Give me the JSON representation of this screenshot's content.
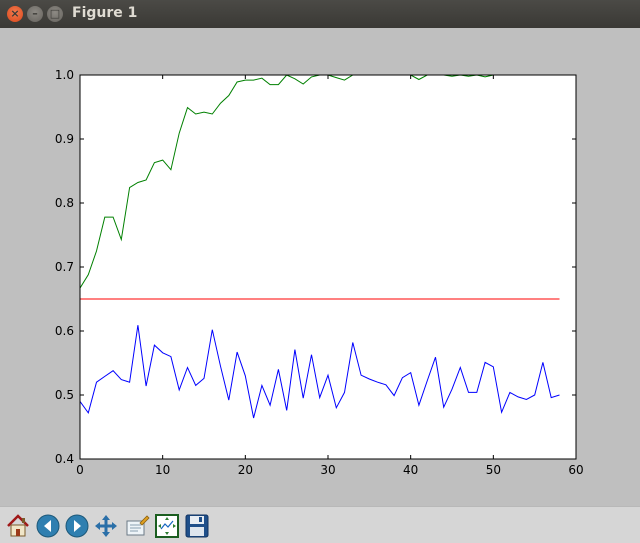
{
  "window": {
    "title": "Figure 1"
  },
  "toolbar": {
    "buttons": [
      {
        "name": "home-button",
        "icon": "home-icon"
      },
      {
        "name": "back-button",
        "icon": "arrow-left-icon"
      },
      {
        "name": "forward-button",
        "icon": "arrow-right-icon"
      },
      {
        "name": "pan-button",
        "icon": "move-icon"
      },
      {
        "name": "zoom-button",
        "icon": "zoom-rect-icon"
      },
      {
        "name": "subplots-button",
        "icon": "configure-subplots-icon"
      },
      {
        "name": "save-button",
        "icon": "floppy-disk-icon"
      }
    ]
  },
  "chart_data": {
    "type": "line",
    "xlim": [
      0,
      60
    ],
    "ylim": [
      0.4,
      1.0
    ],
    "xticks": [
      "0",
      "10",
      "20",
      "30",
      "40",
      "50",
      "60"
    ],
    "yticks": [
      "0.4",
      "0.5",
      "0.6",
      "0.7",
      "0.8",
      "0.9",
      "1.0"
    ],
    "grid": false,
    "series": [
      {
        "color": "#008000",
        "x": [
          0,
          1,
          2,
          3,
          4,
          5,
          6,
          7,
          8,
          9,
          10,
          11,
          12,
          13,
          14,
          15,
          16,
          17,
          18,
          19,
          20,
          21,
          22,
          23,
          24,
          25,
          26,
          27,
          28,
          29,
          30,
          31,
          32,
          33,
          34,
          35,
          36,
          37,
          38,
          39,
          40,
          41,
          42,
          43,
          44,
          45,
          46,
          47,
          48,
          49,
          50
        ],
        "y": [
          0.667,
          0.688,
          0.725,
          0.778,
          0.778,
          0.743,
          0.824,
          0.832,
          0.836,
          0.863,
          0.867,
          0.852,
          0.909,
          0.949,
          0.939,
          0.942,
          0.939,
          0.956,
          0.968,
          0.989,
          0.992,
          0.992,
          0.995,
          0.985,
          0.985,
          1.0,
          0.994,
          0.986,
          0.997,
          1.0,
          1.0,
          0.996,
          0.992,
          1.0,
          1.0,
          1.0,
          1.0,
          1.0,
          1.0,
          1.0,
          1.0,
          0.993,
          1.0,
          1.0,
          1.0,
          0.998,
          1.0,
          0.998,
          1.0,
          0.997,
          1.0
        ]
      },
      {
        "color": "#ff0000",
        "x": [
          0,
          58
        ],
        "y": [
          0.65,
          0.65
        ]
      },
      {
        "color": "#0000ff",
        "x": [
          0,
          1,
          2,
          3,
          4,
          5,
          6,
          7,
          8,
          9,
          10,
          11,
          12,
          13,
          14,
          15,
          16,
          17,
          18,
          19,
          20,
          21,
          22,
          23,
          24,
          25,
          26,
          27,
          28,
          29,
          30,
          31,
          32,
          33,
          34,
          35,
          36,
          37,
          38,
          39,
          40,
          41,
          42,
          43,
          44,
          45,
          46,
          47,
          48,
          49,
          50,
          51,
          52,
          53,
          54,
          55,
          56,
          57,
          58
        ],
        "y": [
          0.49,
          0.472,
          0.52,
          0.529,
          0.538,
          0.524,
          0.52,
          0.609,
          0.514,
          0.578,
          0.566,
          0.56,
          0.508,
          0.543,
          0.515,
          0.526,
          0.602,
          0.545,
          0.492,
          0.567,
          0.53,
          0.464,
          0.515,
          0.484,
          0.54,
          0.476,
          0.571,
          0.495,
          0.563,
          0.496,
          0.531,
          0.48,
          0.504,
          0.582,
          0.531,
          0.525,
          0.52,
          0.516,
          0.499,
          0.527,
          0.535,
          0.484,
          0.522,
          0.559,
          0.481,
          0.509,
          0.543,
          0.504,
          0.504,
          0.551,
          0.544,
          0.473,
          0.504,
          0.497,
          0.493,
          0.5,
          0.551,
          0.496,
          0.5
        ]
      }
    ]
  }
}
